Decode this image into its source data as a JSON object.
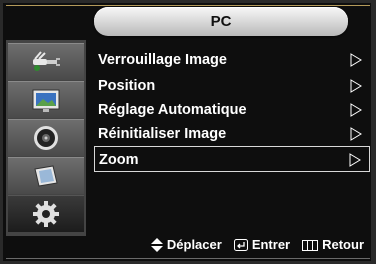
{
  "title": "PC",
  "sidebar": {
    "items": [
      {
        "icon": "antenna-plug-icon",
        "active": false
      },
      {
        "icon": "picture-icon",
        "active": false
      },
      {
        "icon": "speaker-icon",
        "active": false
      },
      {
        "icon": "channel-icon",
        "active": false
      },
      {
        "icon": "gear-icon",
        "active": true
      }
    ]
  },
  "menu": {
    "items": [
      {
        "label": "Verrouillage Image"
      },
      {
        "label": "Position"
      },
      {
        "label": "Réglage Automatique"
      },
      {
        "label": "Réinitialiser Image"
      },
      {
        "label": "Zoom",
        "selected": true
      }
    ]
  },
  "footer": {
    "move": "Déplacer",
    "enter": "Entrer",
    "back": "Retour"
  },
  "colors": {
    "background": "#0e0e0e",
    "title_pill": "#dcdcdc",
    "sidebar": "#4a4a4a",
    "accent_gold": "#b49a5a"
  }
}
